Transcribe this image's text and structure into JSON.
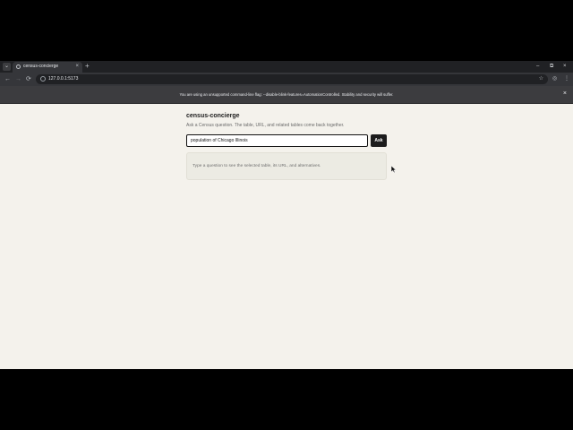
{
  "browser": {
    "tab_menu_glyph": "⌄",
    "tab": {
      "title": "census-concierge",
      "close_glyph": "×"
    },
    "new_tab_glyph": "+",
    "window_controls": {
      "minimize": "–",
      "restore": "⧉",
      "close": "×"
    },
    "nav": {
      "back": "←",
      "forward": "→",
      "reload": "⟳"
    },
    "address": {
      "url": "127.0.0.1:5173",
      "star_glyph": "☆"
    },
    "toolbar_right": {
      "account": "◎",
      "menu": "⋮"
    },
    "infobar": {
      "text": "You are using an unsupported command-line flag: --disable-blink-features=AutomationControlled. Stability and security will suffer.",
      "close_glyph": "×"
    }
  },
  "app": {
    "title": "census-concierge",
    "subtitle": "Ask a Census question. The table, URL, and related tables come back together.",
    "query": {
      "value": "population of Chicago Illinois"
    },
    "ask_label": "Ask",
    "result_placeholder": "Type a question to see the selected table, its URL, and alternatives."
  }
}
